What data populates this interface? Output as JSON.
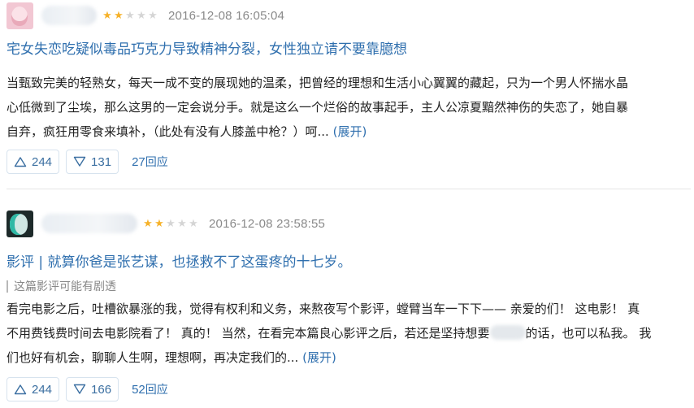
{
  "reviews": [
    {
      "rating_stars": 2,
      "date": "2016-12-08 16:05:04",
      "title": "宅女失恋吃疑似毒品巧克力导致精神分裂，女性独立请不要靠臆想",
      "lines": [
        "当甄致完美的轻熟女，每天一成不变的展现她的温柔，把曾经的理想和生活小心翼翼的藏起，只为一个男人怀揣水晶",
        "心低微到了尘埃，那么这男的一定会说分手。就是这么一个烂俗的故事起手，主人公凉夏黯然神伤的失恋了，她自暴",
        "自弃，疯狂用零食来填补，（此处有没有人膝盖中枪？）呵..."
      ],
      "expand": "(展开)",
      "upvotes": "244",
      "downvotes": "131",
      "reply_count": "27",
      "reply_label": "回应"
    },
    {
      "rating_stars": 2,
      "date": "2016-12-08 23:58:55",
      "title": "影评 | 就算你爸是张艺谋，也拯救不了这蛋疼的十七岁。",
      "spoiler_note": "这篇影评可能有剧透",
      "lines": [
        "看完电影之后，吐槽欲暴涨的我，觉得有权利和义务，来熬夜写个影评，螳臂当车一下下—— 亲爱的们！ 这电影！ 真",
        "不用费钱费时间去电影院看了！ 真的！ 当然，在看完本篇良心影评之后，若还是坚持想要",
        "们也好有机会，聊聊人生啊，理想啊，再决定我们的..."
      ],
      "line2_after_blur": "的话，也可以私我。 我",
      "expand": "(展开)",
      "upvotes": "244",
      "downvotes": "166",
      "reply_count": "52",
      "reply_label": "回应"
    }
  ],
  "icons": {
    "upvote": "triangle-up-outline-icon",
    "downvote": "triangle-down-outline-icon",
    "star": "star-icon"
  },
  "colors": {
    "link": "#2f6fae",
    "star_on": "#f6b22a",
    "star_off": "#d5d5d5",
    "meta": "#8a8a8a"
  }
}
